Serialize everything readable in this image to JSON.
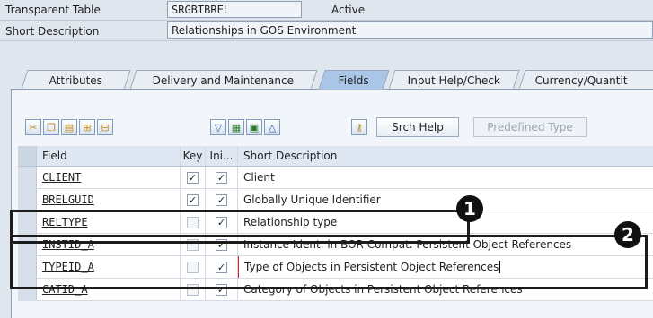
{
  "header": {
    "table_label": "Transparent Table",
    "table_name": "SRGBTBREL",
    "table_status": "Active",
    "short_desc_label": "Short Description",
    "short_desc_value": "Relationships in GOS Environment"
  },
  "tabs": [
    {
      "label": "Attributes"
    },
    {
      "label": "Delivery and Maintenance"
    },
    {
      "label": "Fields",
      "active": true
    },
    {
      "label": "Input Help/Check"
    },
    {
      "label": "Currency/Quantit"
    }
  ],
  "toolbar": {
    "srch_help": "Srch Help",
    "predefined_type": "Predefined Type"
  },
  "grid": {
    "headers": {
      "field": "Field",
      "key": "Key",
      "ini": "Ini...",
      "desc": "Short Description"
    },
    "rows": [
      {
        "field": "CLIENT",
        "key": true,
        "ini": true,
        "desc": "Client"
      },
      {
        "field": "BRELGUID",
        "key": true,
        "ini": true,
        "desc": "Globally Unique Identifier"
      },
      {
        "field": "RELTYPE",
        "key": false,
        "ini": true,
        "desc": "Relationship type"
      },
      {
        "field": "INSTID_A",
        "key": false,
        "ini": true,
        "desc": "Instance Ident. in BOR Compat. Persistent Object References"
      },
      {
        "field": "TYPEID_A",
        "key": false,
        "ini": true,
        "desc": "Type of Objects in Persistent Object References"
      },
      {
        "field": "CATID_A",
        "key": false,
        "ini": true,
        "desc": "Category of Objects in Persistent Object References"
      }
    ]
  },
  "annotations": {
    "badge1": "1",
    "badge2": "2"
  },
  "colors": {
    "active_tab": "#a9c6e8",
    "background": "#dfe6ee",
    "annotation": "#1c1c1c"
  }
}
